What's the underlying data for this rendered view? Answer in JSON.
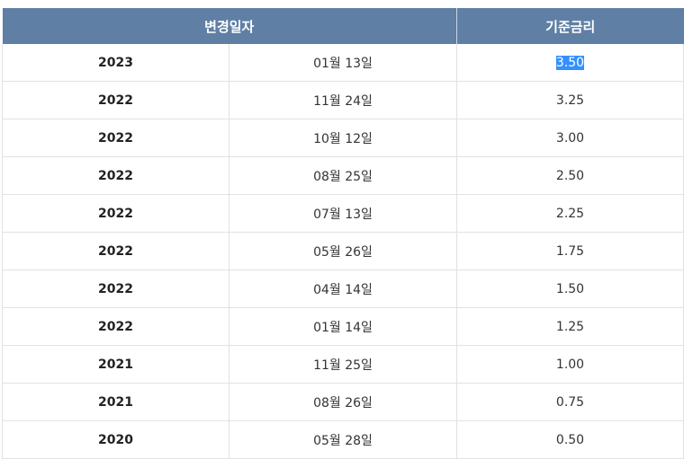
{
  "table": {
    "headers": {
      "change_date": "변경일자",
      "base_rate": "기준금리"
    },
    "rows": [
      {
        "year": "2023",
        "date": "01월 13일",
        "rate": "3.50",
        "selected": true
      },
      {
        "year": "2022",
        "date": "11월 24일",
        "rate": "3.25"
      },
      {
        "year": "2022",
        "date": "10월 12일",
        "rate": "3.00"
      },
      {
        "year": "2022",
        "date": "08월 25일",
        "rate": "2.50"
      },
      {
        "year": "2022",
        "date": "07월 13일",
        "rate": "2.25"
      },
      {
        "year": "2022",
        "date": "05월 26일",
        "rate": "1.75"
      },
      {
        "year": "2022",
        "date": "04월 14일",
        "rate": "1.50"
      },
      {
        "year": "2022",
        "date": "01월 14일",
        "rate": "1.25"
      },
      {
        "year": "2021",
        "date": "11월 25일",
        "rate": "1.00"
      },
      {
        "year": "2021",
        "date": "08월 26일",
        "rate": "0.75"
      },
      {
        "year": "2020",
        "date": "05월 28일",
        "rate": "0.50"
      }
    ]
  },
  "colors": {
    "header_bg": "#5f7fa5",
    "header_text": "#ffffff",
    "selection_bg": "#3390ff",
    "grid_line": "#e2e2e2"
  }
}
